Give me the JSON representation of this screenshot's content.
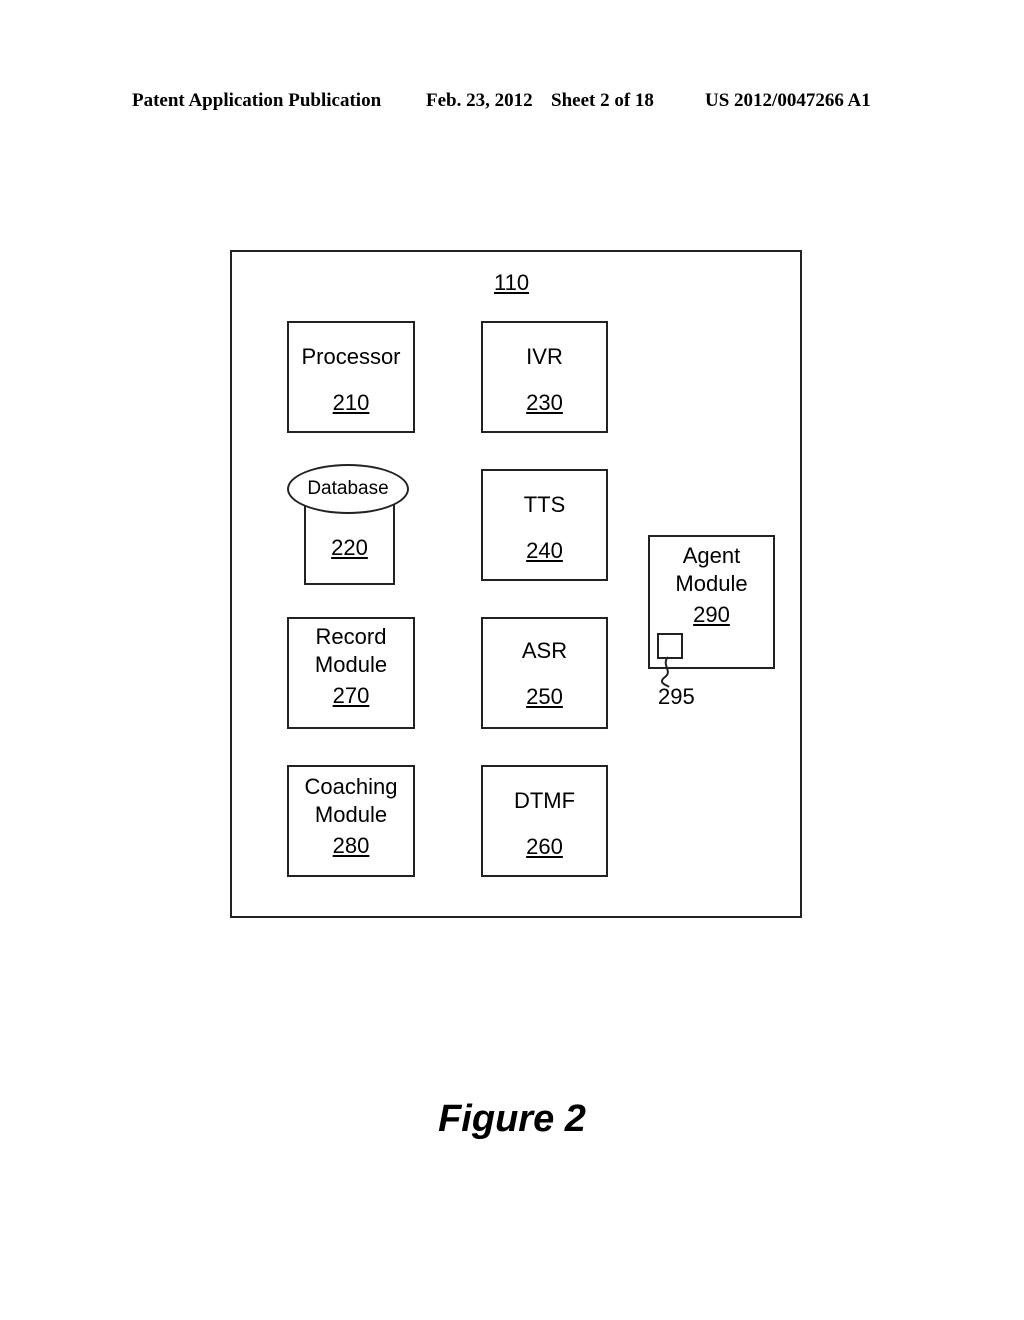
{
  "header": {
    "publication": "Patent Application Publication",
    "date": "Feb. 23, 2012",
    "sheet": "Sheet 2 of 18",
    "number": "US 2012/0047266 A1"
  },
  "diagram": {
    "container_ref": "110",
    "blocks": [
      {
        "name": "Processor",
        "ref": "210"
      },
      {
        "name": "Database",
        "ref": "220"
      },
      {
        "name": "IVR",
        "ref": "230"
      },
      {
        "name": "TTS",
        "ref": "240"
      },
      {
        "name": "ASR",
        "ref": "250"
      },
      {
        "name": "DTMF",
        "ref": "260"
      },
      {
        "name_line1": "Record",
        "name_line2": "Module",
        "ref": "270"
      },
      {
        "name_line1": "Coaching",
        "name_line2": "Module",
        "ref": "280"
      },
      {
        "name_line1": "Agent",
        "name_line2": "Module",
        "ref": "290"
      }
    ],
    "sub_element_ref": "295"
  },
  "caption": "Figure 2"
}
